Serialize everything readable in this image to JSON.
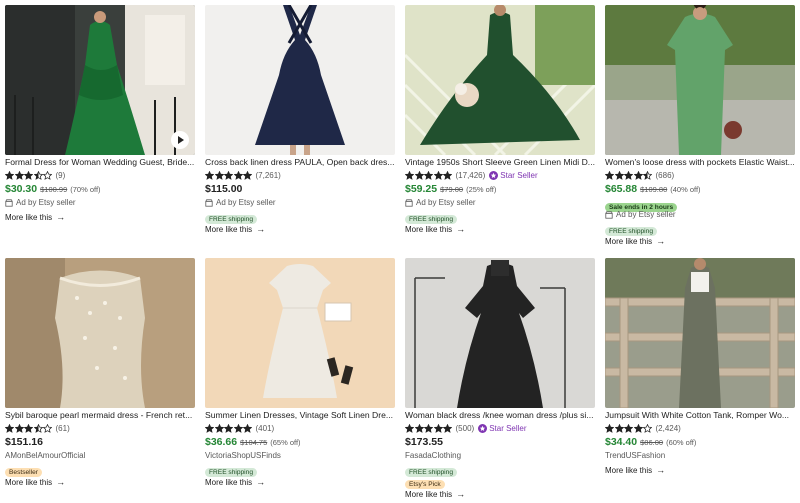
{
  "listings": [
    {
      "title": "Formal Dress for Woman Wedding Guest, Bride...",
      "stars": 3.5,
      "reviews": "(9)",
      "price": "$30.30",
      "price_style": "sale",
      "original_price": "$100.99",
      "discount": "(70% off)",
      "ad_text": "Ad by Etsy seller",
      "more_like_this": "More like this",
      "has_video": true,
      "image": "green-wrap-dress"
    },
    {
      "title": "Cross back linen dress PAULA, Open back dres...",
      "stars": 5,
      "reviews": "(7,261)",
      "price": "$115.00",
      "price_style": "regular",
      "ad_text": "Ad by Etsy seller",
      "badge": "FREE shipping",
      "more_like_this": "More like this",
      "image": "navy-cross-back-dress"
    },
    {
      "title": "Vintage 1950s Short Sleeve Green Linen Midi D...",
      "stars": 5,
      "reviews": "(17,426)",
      "star_seller": "Star Seller",
      "price": "$59.25",
      "price_style": "sale",
      "original_price": "$79.00",
      "discount": "(25% off)",
      "ad_text": "Ad by Etsy seller",
      "badge": "FREE shipping",
      "more_like_this": "More like this",
      "image": "green-swing-dress"
    },
    {
      "title": "Women's loose dress with pockets Elastic Waist...",
      "stars": 4.5,
      "reviews": "(686)",
      "price": "$65.88",
      "price_style": "sale",
      "original_price": "$109.80",
      "discount": "(40% off)",
      "sale_ends": "Sale ends in 2 hours",
      "ad_text": "Ad by Etsy seller",
      "badge": "FREE shipping",
      "more_like_this": "More like this",
      "image": "green-loose-dress"
    },
    {
      "title": "Sybil baroque pearl mermaid dress - French ret...",
      "stars": 3.5,
      "reviews": "(61)",
      "price": "$151.16",
      "price_style": "regular",
      "shop": "AMonBelAmourOfficial",
      "badge": "Bestseller",
      "more_like_this": "More like this",
      "image": "pearl-corset-dress"
    },
    {
      "title": "Summer Linen Dresses, Vintage Soft Linen Dre...",
      "stars": 5,
      "reviews": "(401)",
      "price": "$36.66",
      "price_style": "sale",
      "original_price": "$104.75",
      "discount": "(65% off)",
      "shop": "VictoriaShopUSFinds",
      "badge": "FREE shipping",
      "more_like_this": "More like this",
      "image": "white-linen-dress"
    },
    {
      "title": "Woman black dress /knee woman dress /plus si...",
      "stars": 5,
      "reviews": "(500)",
      "star_seller": "Star Seller",
      "price": "$173.55",
      "price_style": "regular",
      "shop": "FasadaClothing",
      "badge": "FREE shipping",
      "badge2": "Etsy's Pick",
      "more_like_this": "More like this",
      "image": "black-turtleneck-dress"
    },
    {
      "title": "Jumpsuit With White Cotton Tank, Romper Wo...",
      "stars": 4,
      "reviews": "(2,424)",
      "price": "$34.40",
      "price_style": "sale",
      "original_price": "$86.00",
      "discount": "(60% off)",
      "shop": "TrendUSFashion",
      "more_like_this": "More like this",
      "image": "grey-linen-jumpsuit"
    }
  ],
  "colors": {
    "sale_price": "#258635",
    "star": "#222222",
    "star_seller": "#7f35b2",
    "free_shipping_bg": "#d4e9d7",
    "bestseller_bg": "#fddfb3"
  }
}
